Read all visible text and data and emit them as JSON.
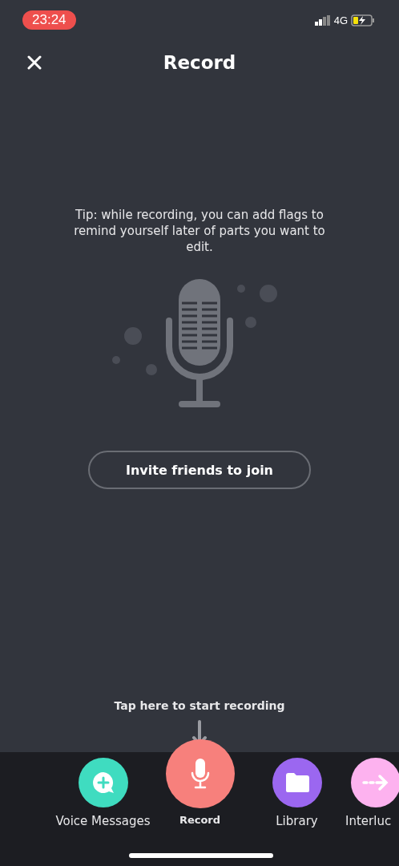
{
  "status_bar": {
    "time": "23:24",
    "network": "4G"
  },
  "header": {
    "title": "Record"
  },
  "tip": "Tip: while recording, you can add flags to remind yourself later of parts you want to edit.",
  "invite_button": "Invite friends to join",
  "hint": "Tap here to start recording",
  "bottom_bar": [
    {
      "label": "Voice Messages",
      "kind": "chat",
      "color": "#3fdcc0",
      "selected": false
    },
    {
      "label": "Record",
      "kind": "mic",
      "color": "#f7807c",
      "selected": true
    },
    {
      "label": "Library",
      "kind": "folder",
      "color": "#9b67f0",
      "selected": false
    },
    {
      "label": "Interluc",
      "kind": "arrow",
      "color": "#fdb2ef",
      "selected": false
    }
  ]
}
